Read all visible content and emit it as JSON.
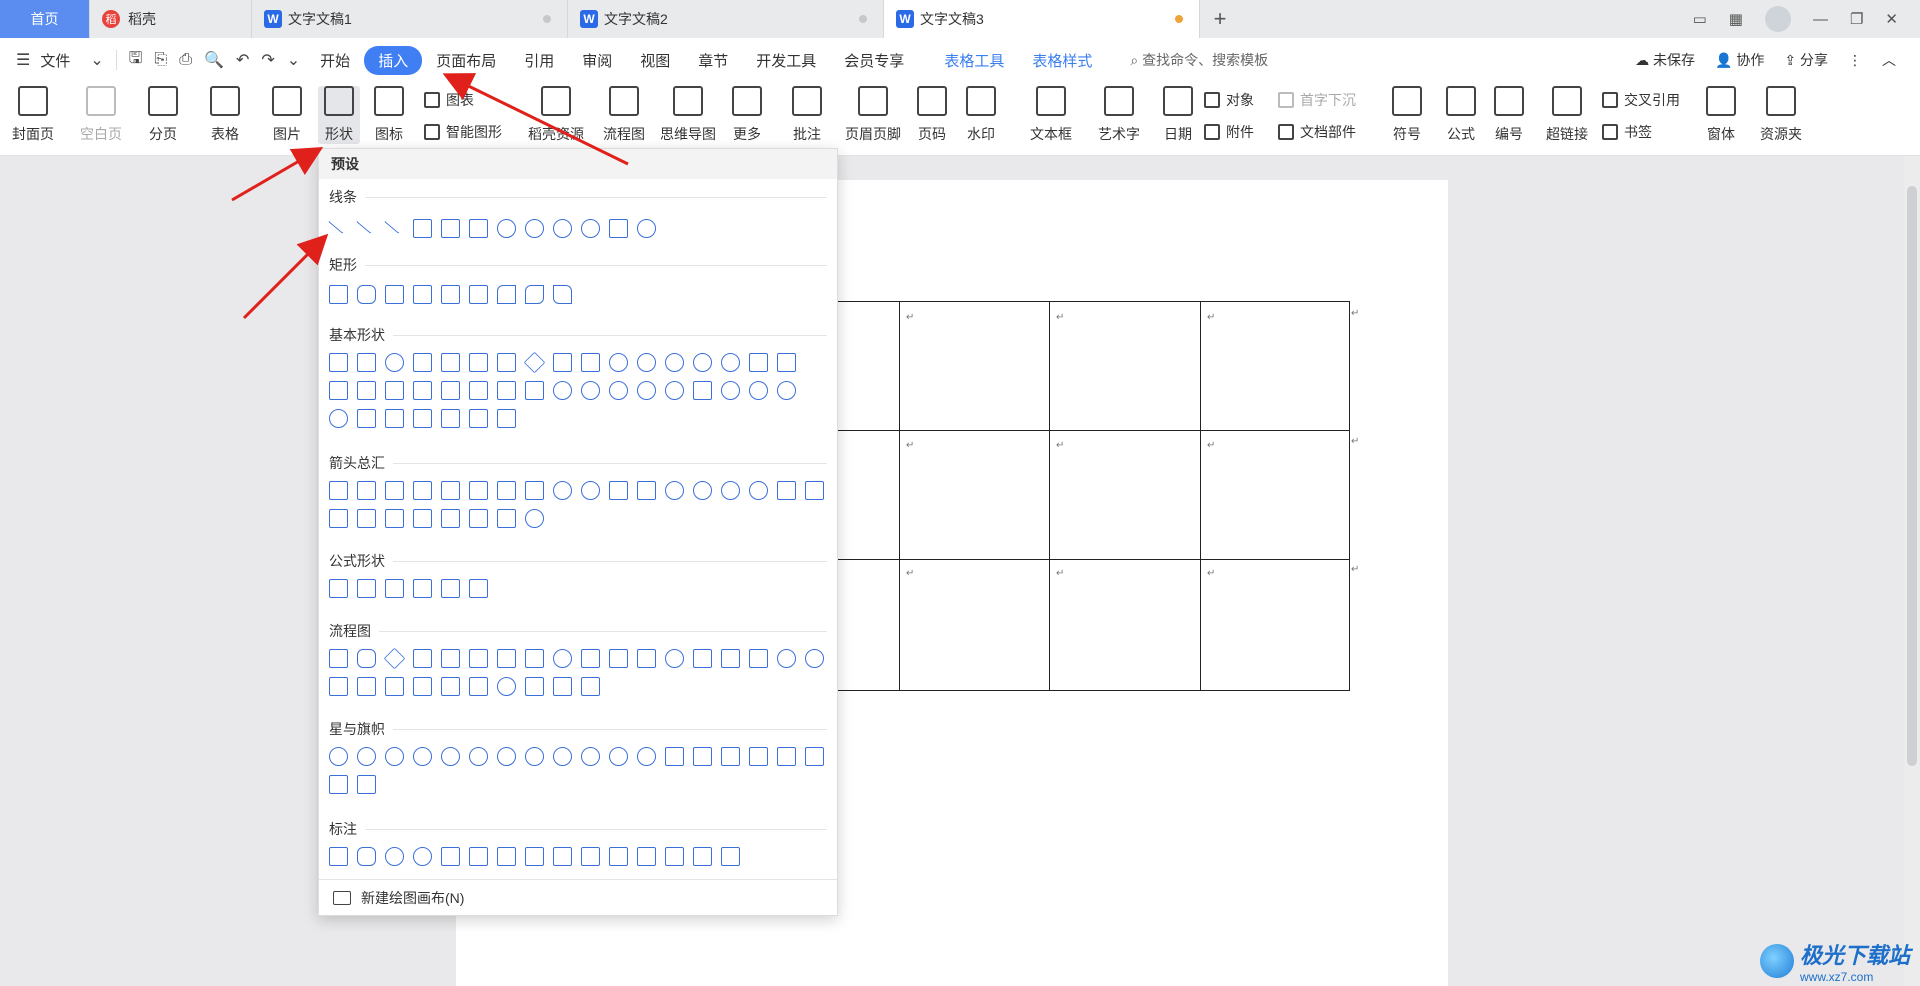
{
  "tabs": {
    "home": "首页",
    "daoke": "稻壳",
    "doc1": "文字文稿1",
    "doc2": "文字文稿2",
    "doc3": "文字文稿3",
    "add": "+"
  },
  "menu": {
    "file": "文件",
    "items": [
      "开始",
      "插入",
      "页面布局",
      "引用",
      "审阅",
      "视图",
      "章节",
      "开发工具",
      "会员专享"
    ],
    "table_tools": "表格工具",
    "table_style": "表格样式",
    "search": "查找命令、搜索模板",
    "unsaved": "未保存",
    "collab": "协作",
    "share": "分享"
  },
  "ribbon": {
    "cover": "封面页",
    "blank": "空白页",
    "pagebreak": "分页",
    "table": "表格",
    "picture": "图片",
    "shape": "形状",
    "icon": "图标",
    "chart": "图表",
    "smart_shape": "智能图形",
    "daoke_res": "稻壳资源",
    "flowchart": "流程图",
    "mindmap": "思维导图",
    "more": "更多",
    "comment": "批注",
    "header_footer": "页眉页脚",
    "page_num": "页码",
    "watermark": "水印",
    "textbox": "文本框",
    "wordart": "艺术字",
    "date": "日期",
    "object": "对象",
    "dropcap": "首字下沉",
    "attachment": "附件",
    "doc_parts": "文档部件",
    "symbol": "符号",
    "formula": "公式",
    "numbering": "编号",
    "hyperlink": "超链接",
    "crossref": "交叉引用",
    "bookmark": "书签",
    "window": "窗体",
    "resource": "资源夹"
  },
  "dropdown": {
    "header": "预设",
    "sections": [
      "线条",
      "矩形",
      "基本形状",
      "箭头总汇",
      "公式形状",
      "流程图",
      "星与旗帜",
      "标注"
    ],
    "footer": "新建绘图画布(N)"
  },
  "watermark": {
    "name": "极光下载站",
    "url": "www.xz7.com"
  }
}
